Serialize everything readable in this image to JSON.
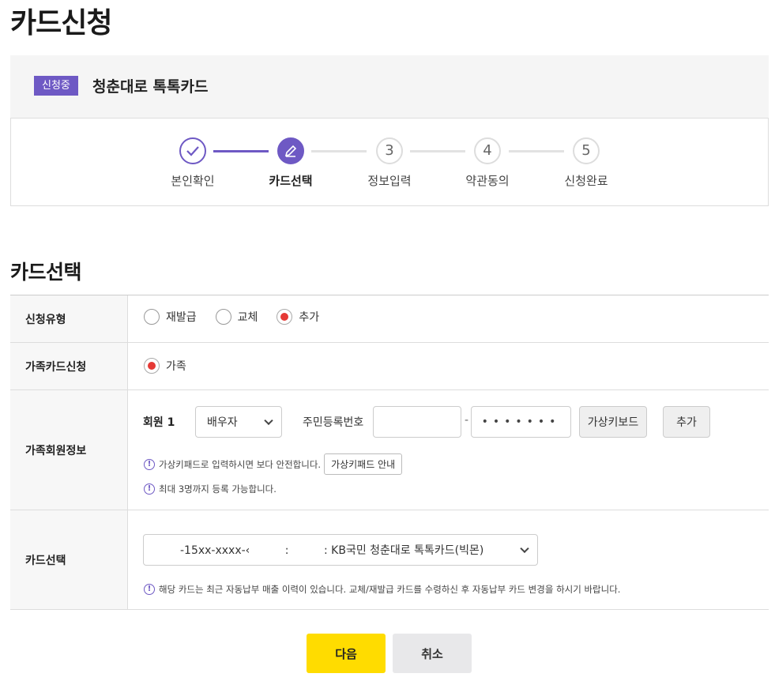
{
  "page": {
    "title": "카드신청"
  },
  "status": {
    "badge": "신청중",
    "card_name": "청춘대로 톡톡카드"
  },
  "steps": [
    {
      "num": "",
      "label": "본인확인",
      "state": "done"
    },
    {
      "num": "",
      "label": "카드선택",
      "state": "active"
    },
    {
      "num": "3",
      "label": "정보입력",
      "state": "pending"
    },
    {
      "num": "4",
      "label": "약관동의",
      "state": "pending"
    },
    {
      "num": "5",
      "label": "신청완료",
      "state": "pending"
    }
  ],
  "section": {
    "title": "카드선택"
  },
  "form": {
    "apply_type": {
      "label": "신청유형",
      "options": [
        "재발급",
        "교체",
        "추가"
      ],
      "selected": "추가"
    },
    "family_card": {
      "label": "가족카드신청",
      "option": "가족"
    },
    "family_member": {
      "label": "가족회원정보",
      "member_label": "회원 1",
      "relation": "배우자",
      "rrn_label": "주민등록번호",
      "rrn_front": "",
      "rrn_dash": "-",
      "rrn_back_mask": "•••••••",
      "virtual_keyboard_button": "가상키보드",
      "add_button": "추가",
      "note1": "가상키패드로 입력하시면 보다 안전합니다.",
      "keypad_guide_button": "가상키패드 안내",
      "note2": "최대 3명까지 등록 가능합니다."
    },
    "card_select": {
      "label": "카드선택",
      "value": "-15xx-xxxx-‹          :          : KB국민 청춘대로 톡톡카드(빅몬)",
      "note": "해당 카드는 최근 자동납부 매출 이력이 있습니다. 교체/재발급 카드를 수령하신 후 자동납부 카드 변경을 하시기 바랍니다."
    }
  },
  "actions": {
    "next": "다음",
    "cancel": "취소"
  },
  "colors": {
    "accent": "#6e59c4",
    "primary_button": "#ffdc00",
    "radio_checked": "#e53935"
  },
  "icons": {
    "done_step": "check-icon",
    "active_step": "pencil-icon",
    "note": "exclamation-icon",
    "dropdown": "chevron-down-icon"
  }
}
